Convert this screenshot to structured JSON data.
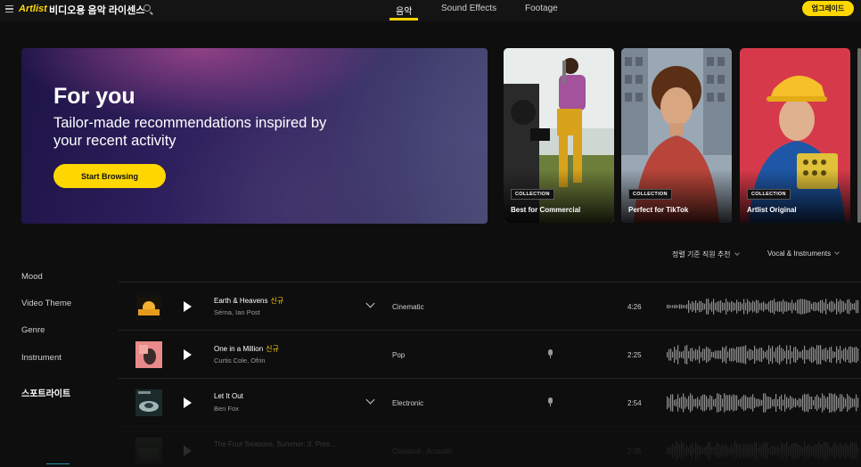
{
  "header": {
    "logo": "Artlist",
    "site_title": "비디오용 음악 라이센스",
    "tabs": [
      {
        "label": "음악",
        "active": true
      },
      {
        "label": "Sound Effects",
        "active": false
      },
      {
        "label": "Footage",
        "active": false
      }
    ],
    "upgrade_label": "업그레이드"
  },
  "hero": {
    "title": "For you",
    "subtitle": "Tailor-made recommendations inspired by your recent activity",
    "button_label": "Start Browsing"
  },
  "collections": [
    {
      "badge": "COLLECTION",
      "title": "Best for Commercial"
    },
    {
      "badge": "COLLECTION",
      "title": "Perfect for TikTok"
    },
    {
      "badge": "COLLECTION",
      "title": "Artlist Original"
    }
  ],
  "sort": {
    "sort_label": "정렬 기준 직원 추천",
    "filter_label": "Vocal & Instruments"
  },
  "sidebar": {
    "items": [
      "Mood",
      "Video Theme",
      "Genre",
      "Instrument",
      "스포트라이트"
    ]
  },
  "tracks": [
    {
      "title": "Earth & Heavens",
      "new_badge": "신규",
      "artist": "Sérna, Ian Post",
      "genre": "Cinematic",
      "duration": "4:26",
      "vocal": false,
      "expandable": true
    },
    {
      "title": "One in a Million",
      "new_badge": "신규",
      "artist": "Curtis Cole, Ofrin",
      "genre": "Pop",
      "duration": "2:25",
      "vocal": true,
      "expandable": false
    },
    {
      "title": "Let It Out",
      "new_badge": "",
      "artist": "Ben Fox",
      "genre": "Electronic",
      "duration": "2:54",
      "vocal": true,
      "expandable": true
    },
    {
      "title": "The Four Seasons, Summer: 3. Pres...",
      "new_badge": "",
      "artist": "",
      "genre": "Classical , Acoustic",
      "duration": "2:35",
      "vocal": false,
      "expandable": false
    }
  ],
  "colors": {
    "accent": "#ffd700",
    "background": "#0e0e0e"
  }
}
